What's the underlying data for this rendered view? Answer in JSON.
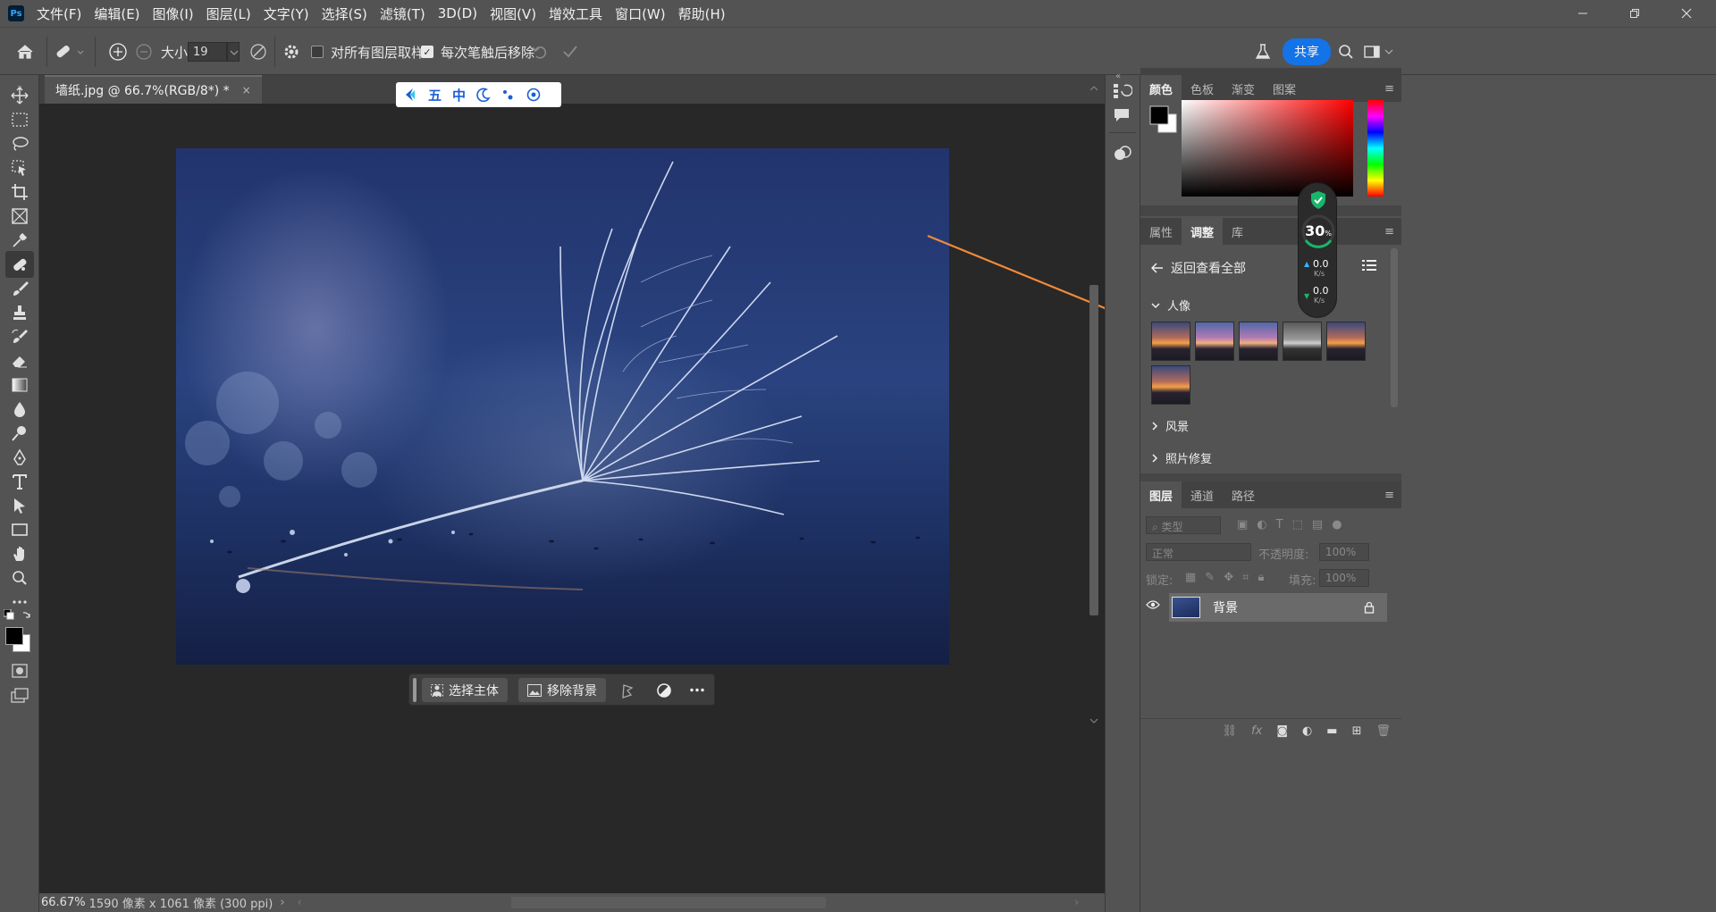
{
  "app": {
    "logo": "Ps"
  },
  "menu": [
    "文件(F)",
    "编辑(E)",
    "图像(I)",
    "图层(L)",
    "文字(Y)",
    "选择(S)",
    "滤镜(T)",
    "3D(D)",
    "视图(V)",
    "增效工具",
    "窗口(W)",
    "帮助(H)"
  ],
  "options": {
    "size_label": "大小",
    "size_value": "19",
    "sample_all_layers": "对所有图层取样",
    "remove_after_stroke": "每次笔触后移除",
    "share": "共享"
  },
  "document": {
    "tab_title": "墙纸.jpg @ 66.7%(RGB/8*) *",
    "tab_close": "×"
  },
  "ime": {
    "char1": "五",
    "char2": "中"
  },
  "context_bar": {
    "select_subject": "选择主体",
    "remove_background": "移除背景"
  },
  "status": {
    "zoom": "66.67%",
    "doc_info": "1590 像素 x 1061 像素 (300 ppi)"
  },
  "panels": {
    "color_tabs": [
      "颜色",
      "色板",
      "渐变",
      "图案"
    ],
    "adjust_tabs": [
      "属性",
      "调整",
      "库"
    ],
    "back_label": "返回查看全部",
    "sections": {
      "portrait": "人像",
      "landscape": "风景",
      "photo_repair": "照片修复"
    },
    "layers_tabs": [
      "图层",
      "通道",
      "路径"
    ],
    "filter_placeholder": "类型",
    "blend_mode": "正常",
    "opacity_label": "不透明度:",
    "opacity_value": "100%",
    "lock_label": "锁定:",
    "fill_label": "填充:",
    "fill_value": "100%",
    "layer_name": "背景"
  },
  "net_widget": {
    "percent": "30",
    "percent_unit": "%",
    "up_speed": "0.0",
    "down_speed": "0.0",
    "unit": "K/s"
  },
  "colors": {
    "accent": "#1473e6",
    "arrow": "#f28a3a",
    "bg": "#535353",
    "canvas_bg": "#282828"
  }
}
